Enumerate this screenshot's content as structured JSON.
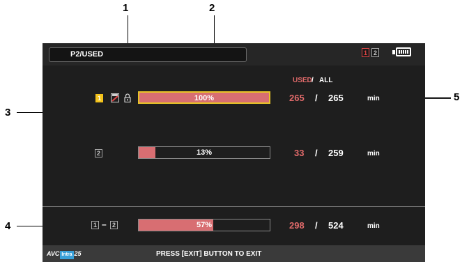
{
  "title": "P2/USED",
  "status": {
    "card1": "1",
    "card2": "2"
  },
  "columns": {
    "used": "USED",
    "slash": "/",
    "all": "ALL"
  },
  "rows": [
    {
      "slot": "1",
      "percent_label": "100%",
      "fill": 1.0,
      "used": "265",
      "slash": "/",
      "all": "265",
      "unit": "min"
    },
    {
      "slot": "2",
      "percent_label": "13%",
      "fill": 0.13,
      "used": "33",
      "slash": "/",
      "all": "259",
      "unit": "min"
    }
  ],
  "total": {
    "slot_from": "1",
    "dash": "–",
    "slot_to": "2",
    "percent_label": "57%",
    "fill": 0.57,
    "used": "298",
    "slash": "/",
    "all": "524",
    "unit": "min"
  },
  "footer": {
    "avc_left": "AVC",
    "avc_mid": "Intra",
    "avc_right": "25",
    "message": "PRESS [EXIT] BUTTON TO EXIT"
  },
  "callouts": [
    "1",
    "2",
    "3",
    "4",
    "5"
  ],
  "colors": {
    "used_red": "#e06a6a",
    "bar_fill": "#d86e72",
    "select_yellow": "#e8c428"
  }
}
